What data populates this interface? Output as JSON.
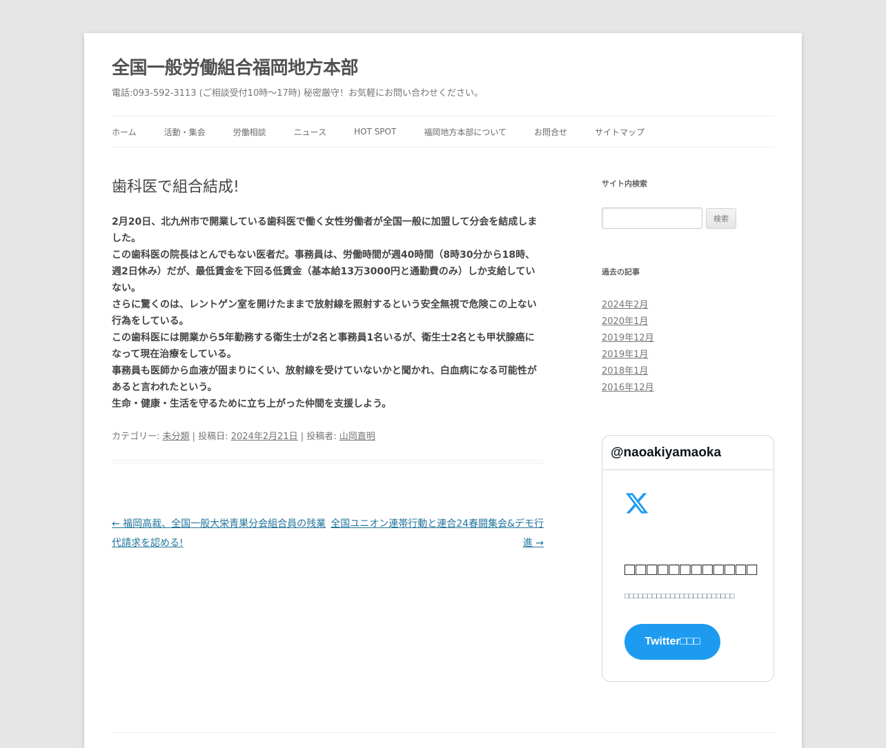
{
  "site": {
    "title": "全国一般労働組合福岡地方本部",
    "description": "電話:093-592-3113 (ご相談受付10時〜17時) 秘密厳守！お気軽にお問い合わせください。"
  },
  "nav": {
    "items": [
      "ホーム",
      "活動・集会",
      "労働相談",
      "ニュース",
      "HOT SPOT",
      "福岡地方本部について",
      "お問合せ",
      "サイトマップ"
    ]
  },
  "article": {
    "title": "歯科医で組合結成!",
    "paragraphs": [
      "2月20日、北九州市で開業している歯科医で働く女性労働者が全国一般に加盟して分会を結成しました。",
      "この歯科医の院長はとんでもない医者だ。事務員は、労働時間が週40時間（8時30分から18時、週2日休み）だが、最低賃金を下回る低賃金（基本給13万3000円と通勤費のみ）しか支給していない。",
      "さらに驚くのは、レントゲン室を開けたままで放射線を照射するという安全無視で危険この上ない行為をしている。",
      "この歯科医には開業から5年勤務する衛生士が2名と事務員1名いるが、衛生士2名とも甲状腺癌になって現在治療をしている。",
      "事務員も医師から血液が固まりにくい、放射線を受けていないかと聞かれ、白血病になる可能性があると言われたという。",
      "生命・健康・生活を守るために立ち上がった仲間を支援しよう。"
    ],
    "meta": {
      "category_label": "カテゴリー: ",
      "category": "未分類",
      "sep1": " | 投稿日: ",
      "date": "2024年2月21日",
      "sep2": " | 投稿者: ",
      "author": "山岡直明"
    }
  },
  "post_nav": {
    "prev": "← 福岡高裁、全国一般大栄青果分会組合員の残業代請求を認める!",
    "next": "全国ユニオン連帯行動と連合24春闘集会&デモ行進 →"
  },
  "sidebar": {
    "search_title": "サイト内検索",
    "search_value": "",
    "search_button": "検索",
    "archive_title": "過去の記事",
    "archives": [
      "2024年2月",
      "2020年1月",
      "2019年12月",
      "2019年1月",
      "2018年1月",
      "2016年12月"
    ]
  },
  "twitter": {
    "header": "@naoakiyamaoka",
    "logo_icon": "x-logo-icon",
    "brand_color": "#1d9bf0",
    "button_label": "Twitter"
  }
}
